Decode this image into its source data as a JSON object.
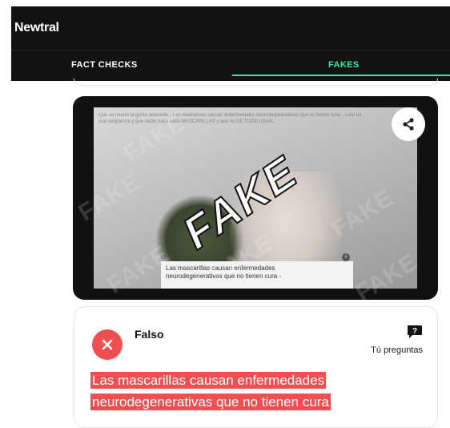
{
  "header": {
    "logo": "Newtral"
  },
  "tabs": [
    {
      "label": "FACT CHECKS",
      "active": false
    },
    {
      "label": "FAKES",
      "active": true
    }
  ],
  "image_card": {
    "stamp": "FAKE",
    "watermark": "FAKE",
    "post_text": "Que se muere la gente asfixiada... Las mascarillas causan enfermedades neurodegenerativas que no tienen cura... Esto es una vergüenza y que nadie hace nada MASCARILLAS y que no DE TODO IGUAL",
    "caption": "Las mascarillas causan enfermedades neurodegenerativas que no tienen cura -",
    "share_icon": "share-icon"
  },
  "verdict": {
    "label": "Falso",
    "ask_label": "Tú preguntas",
    "claim": "Las mascarillas causan enfermedades neurodegenerativas que no tienen cura"
  },
  "colors": {
    "accent": "#39e3b0",
    "false_red": "#ef4f50",
    "header_bg": "#121212"
  }
}
